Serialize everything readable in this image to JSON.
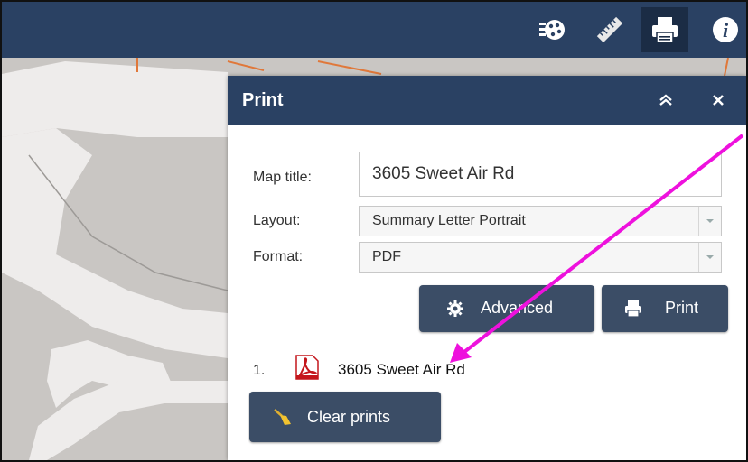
{
  "toolbar": {
    "tools": [
      {
        "icon": "basemap-icon"
      },
      {
        "icon": "measure-ruler-icon"
      },
      {
        "icon": "printer-icon",
        "active": true
      },
      {
        "icon": "info-icon"
      }
    ],
    "info_glyph": "i"
  },
  "panel": {
    "title": "Print",
    "collapse_glyph": "≈",
    "close_glyph": "×",
    "map_title_label": "Map title:",
    "map_title_value": "3605 Sweet Air Rd",
    "layout_label": "Layout:",
    "layout_value": "Summary Letter Portrait",
    "format_label": "Format:",
    "format_value": "PDF",
    "advanced_label": "Advanced",
    "print_label": "Print",
    "results": [
      {
        "number": "1.",
        "name": "3605 Sweet Air Rd",
        "file_icon": "pdf-icon"
      }
    ],
    "clear_label": "Clear prints"
  },
  "colors": {
    "header": "#2a4163",
    "button": "#3b4d66",
    "annotation_arrow": "#ee11dd",
    "map_bg": "#c9c6c3",
    "map_road": "#eeeceb"
  }
}
